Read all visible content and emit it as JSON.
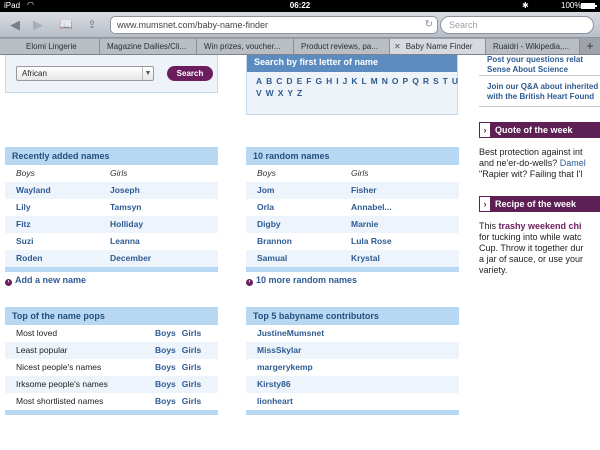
{
  "status": {
    "carrier": "iPad",
    "time": "06:22",
    "battery": "100%"
  },
  "browser": {
    "url": "www.mumsnet.com/baby-name-finder",
    "search_placeholder": "Search",
    "tabs": [
      {
        "label": "Elomi Lingerie"
      },
      {
        "label": "Magazine Dailies/Cli..."
      },
      {
        "label": "Win prizes, voucher..."
      },
      {
        "label": "Product reviews, pa..."
      },
      {
        "label": "Baby Name Finder"
      },
      {
        "label": "Ruaidri - Wikipedia,..."
      }
    ]
  },
  "finder": {
    "origin_value": "African",
    "search_label": "Search"
  },
  "letters": {
    "title": "Search by first letter of name",
    "list": [
      "A",
      "B",
      "C",
      "D",
      "E",
      "F",
      "G",
      "H",
      "I",
      "J",
      "K",
      "L",
      "M",
      "N",
      "O",
      "P",
      "Q",
      "R",
      "S",
      "T",
      "U",
      "V",
      "W",
      "X",
      "Y",
      "Z"
    ]
  },
  "recent": {
    "title": "Recently added names",
    "col_boys": "Boys",
    "col_girls": "Girls",
    "rows": [
      {
        "boy": "Wayland",
        "girl": "Joseph"
      },
      {
        "boy": "Lily",
        "girl": "Tamsyn"
      },
      {
        "boy": "Fitz",
        "girl": "Holliday"
      },
      {
        "boy": "Suzi",
        "girl": "Leanna"
      },
      {
        "boy": "Roden",
        "girl": "December"
      }
    ],
    "add_link": "Add a new name"
  },
  "random": {
    "title": "10 random names",
    "col_boys": "Boys",
    "col_girls": "Girls",
    "rows": [
      {
        "boy": "Jom",
        "girl": "Fisher"
      },
      {
        "boy": "Orla",
        "girl": "Annabel..."
      },
      {
        "boy": "Digby",
        "girl": "Marnie"
      },
      {
        "boy": "Brannon",
        "girl": "Lula Rose"
      },
      {
        "boy": "Samual",
        "girl": "Krystal"
      }
    ],
    "more_link": "10 more random names"
  },
  "pops": {
    "title": "Top of the name pops",
    "boys_label": "Boys",
    "girls_label": "Girls",
    "rows": [
      {
        "label": "Most loved"
      },
      {
        "label": "Least popular"
      },
      {
        "label": "Nicest people's names"
      },
      {
        "label": "Irksome people's names"
      },
      {
        "label": "Most shortlisted names"
      }
    ]
  },
  "contributors": {
    "title": "Top 5 babyname contributors",
    "rows": [
      {
        "name": "JustineMumsnet"
      },
      {
        "name": "MissSkylar"
      },
      {
        "name": "margerykemp"
      },
      {
        "name": "Kirsty86"
      },
      {
        "name": "lionheart"
      }
    ]
  },
  "sidebar": {
    "links": [
      {
        "l1": "Post your questions relat",
        "l2": "Sense About Science"
      },
      {
        "l1": "Join our Q&A about inherited",
        "l2": "with the British Heart Found"
      }
    ],
    "quote_title": "Quote of the week",
    "quote_lines": {
      "l1": "Best protection against int",
      "l2a": "and ne'er-do-wells? ",
      "l2b": "Damel",
      "l3": "\"Rapier wit? Failing that I'l"
    },
    "recipe_title": "Recipe of the week",
    "recipe_lines": {
      "l1a": "This ",
      "l1b": "trashy weekend chi",
      "l2": "for tucking into while watc",
      "l3": "Cup. Throw it together dur",
      "l4": "a jar of sauce, or use your",
      "l5": "variety."
    }
  }
}
